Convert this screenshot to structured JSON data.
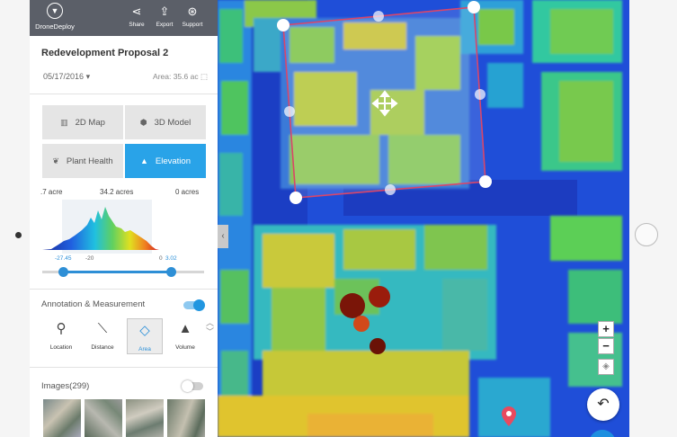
{
  "app": {
    "brand": "DroneDeploy"
  },
  "toolbar": {
    "share": "Share",
    "export": "Export",
    "support": "Support"
  },
  "project": {
    "name": "Redevelopment Proposal 2",
    "date": "05/17/2016",
    "area": "Area: 35.6 ac"
  },
  "views": {
    "map2d": "2D Map",
    "model3d": "3D Model",
    "plant_health": "Plant Health",
    "elevation": "Elevation",
    "active": "elevation"
  },
  "elevation": {
    "left_area": ".7 acre",
    "center_area": "34.2 acres",
    "right_area": "0 acres",
    "range_min": "-27.45",
    "range_mid": "-20",
    "range_zero": "0",
    "range_max": "3.02"
  },
  "annotation": {
    "title": "Annotation & Measurement",
    "enabled": true,
    "tools": {
      "location": "Location",
      "distance": "Distance",
      "area": "Area",
      "volume": "Volume"
    },
    "active_tool": "area"
  },
  "images": {
    "title": "Images(299)",
    "enabled": false
  },
  "map_controls": {
    "zoom_in": "+",
    "zoom_out": "−"
  },
  "colors": {
    "accent": "#29a3e8",
    "topbar": "#5b5f68",
    "polygon": "#d9466a"
  }
}
